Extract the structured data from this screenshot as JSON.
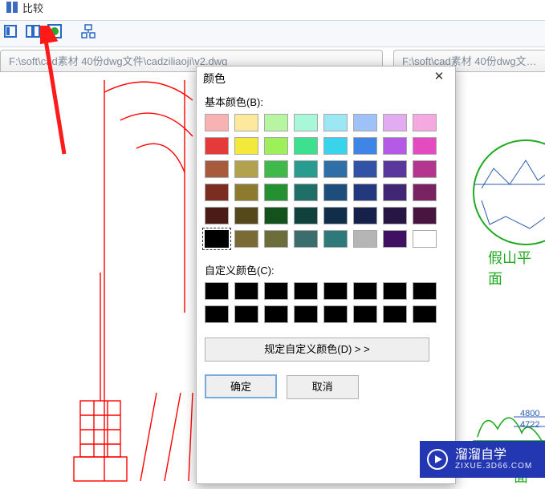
{
  "window": {
    "title": "比较"
  },
  "toolbar": {
    "btn1": "view-mode-1",
    "btn2": "view-mode-2",
    "btn3": "highlight-toggle",
    "btn4": "settings"
  },
  "tabs": {
    "tab1_path": "F:\\soft\\cad素材 40份dwg文件\\cadziliaoji\\v2.dwg",
    "tab2_path": "F:\\soft\\cad素材 40份dwg文…"
  },
  "right_labels": {
    "plan": "假山平面",
    "elev": "山立面"
  },
  "dims": {
    "d1": "4800",
    "d2": "4722"
  },
  "dialog": {
    "title": "颜色",
    "basic_label": "基本颜色(B):",
    "custom_label": "自定义颜色(C):",
    "define_btn": "规定自定义颜色(D) > >",
    "ok": "确定",
    "cancel": "取消",
    "basic_colors": [
      "#f9b2b2",
      "#fce99d",
      "#b8f5a1",
      "#a7f7d8",
      "#9be8f4",
      "#9ec2f7",
      "#e3abf2",
      "#f6a8e0",
      "#e53a3a",
      "#f3e93b",
      "#9df05a",
      "#3de08f",
      "#39d4ec",
      "#3e85e6",
      "#b45ae6",
      "#e44bc1",
      "#a85a3c",
      "#b2a24e",
      "#3fb949",
      "#289c8f",
      "#2d6fa6",
      "#3152a6",
      "#5a379c",
      "#b5368e",
      "#7b2d22",
      "#8c7a2e",
      "#239131",
      "#1d6f68",
      "#1c4d7b",
      "#23397d",
      "#412773",
      "#7a2362",
      "#4a1c15",
      "#55491c",
      "#14521d",
      "#11413d",
      "#102d4a",
      "#15214a",
      "#271544",
      "#491440",
      "#000000",
      "#7a6b34",
      "#6d6d3c",
      "#3b6d6d",
      "#2e7a7a",
      "#b5b5b5",
      "#401062",
      "#ffffff"
    ],
    "selected_index": 40,
    "custom_count": 16
  },
  "watermark": {
    "name": "溜溜自学",
    "url": "ZIXUE.3D66.COM"
  }
}
